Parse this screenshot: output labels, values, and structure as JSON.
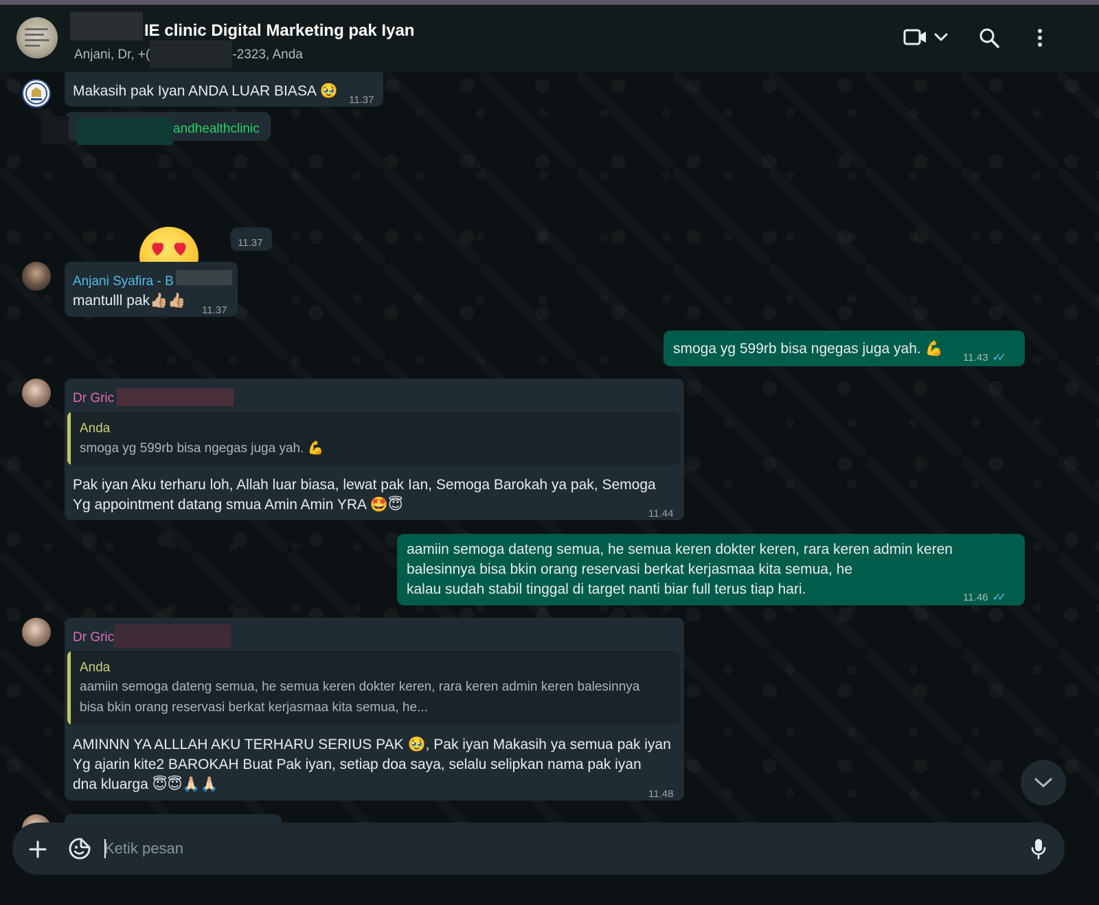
{
  "header": {
    "title": "IE clinic Digital Marketing pak Iyan",
    "subtitle_start": "Anjani, Dr, +(",
    "subtitle_end": "-2323, Anda",
    "icons": [
      "video-call-icon",
      "chevron-down-icon",
      "search-icon",
      "menu-icon"
    ]
  },
  "messages": [
    {
      "type": "incoming",
      "text": "Makasih pak Iyan ANDA LUAR BIASA",
      "emoji": "🥹",
      "time": "11.37"
    },
    {
      "type": "incoming",
      "sender": "andhealthclinic",
      "emoji": "😍",
      "time": "11.37"
    },
    {
      "type": "incoming",
      "sender": "Anjani Syafira - B",
      "text": "mantulll pak",
      "emoji": "👍🏼👍🏼",
      "time": "11.37",
      "sender_color": "#53bdeb"
    },
    {
      "type": "outgoing",
      "text": "smoga yg 599rb bisa ngegas juga yah.",
      "emoji": "💪",
      "time": "11.43"
    },
    {
      "type": "incoming",
      "sender": "Dr Gric",
      "sender_color": "#e26ab6",
      "quote": {
        "name": "Anda",
        "text": "smoga yg 599rb bisa ngegas juga yah.",
        "emoji": "💪"
      },
      "lines": [
        "Pak iyan Aku terharu loh, Allah luar biasa, lewat pak Ian, Semoga Barokah ya pak, Semoga",
        "Yg appointment datang smua Amin Amin YRA"
      ],
      "emoji": "🤩😇",
      "time": "11.44"
    },
    {
      "type": "outgoing",
      "lines": [
        "aamiin semoga dateng semua, he semua keren dokter keren, rara keren admin keren",
        "balesinnya bisa bkin orang reservasi berkat kerjasmaa kita semua, he",
        "kalau sudah stabil tinggal di target nanti biar full terus tiap hari."
      ],
      "time": "11.46"
    },
    {
      "type": "incoming",
      "sender": "Dr Gric",
      "sender_color": "#e26ab6",
      "quote": {
        "name": "Anda",
        "lines": [
          "aamiin semoga dateng semua, he semua keren dokter keren, rara keren admin keren balesinnya",
          "bisa bkin orang reservasi berkat kerjasmaa kita semua, he..."
        ]
      },
      "lines": [
        "AMINNN YA ALLLAH AKU TERHARU SERIUS PAK",
        ", Pak iyan Makasih ya semua pak iyan",
        "Yg ajarin kite2 BAROKAH Buat  Pak iyan, setiap doa saya, selalu selipkan nama pak iyan",
        "dna kluarga"
      ],
      "emoji_inline": "🥹",
      "emoji_end": "😇😇🙏🏻🙏🏻",
      "time": "11.48"
    }
  ],
  "composer": {
    "placeholder": "Ketik pesan",
    "icons": [
      "plus-icon",
      "sticker-icon",
      "microphone-icon"
    ]
  },
  "colors": {
    "incoming_bubble": "#202c33",
    "outgoing_bubble": "#005c4b",
    "read_receipt": "#53bdeb",
    "mention": "#25d366"
  }
}
